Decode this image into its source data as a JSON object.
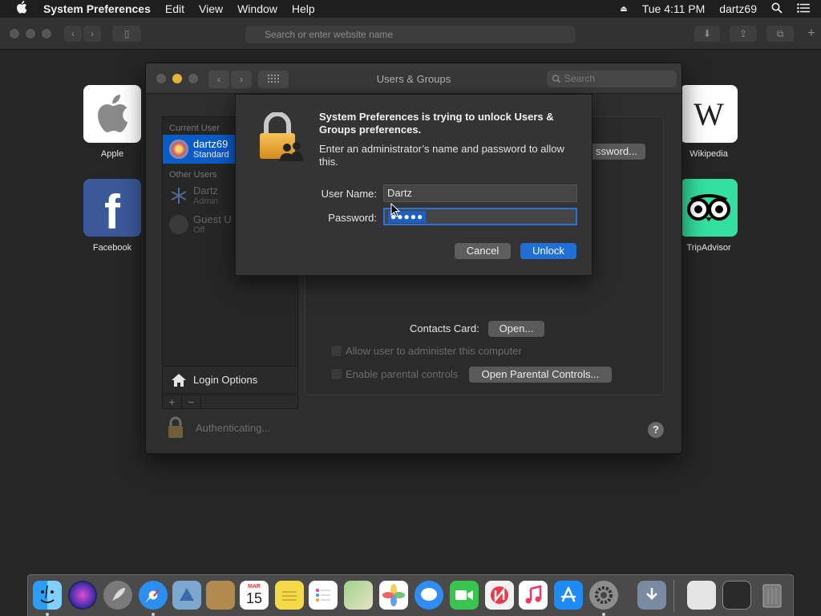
{
  "menubar": {
    "app_name": "System Preferences",
    "menus": [
      "Edit",
      "View",
      "Window",
      "Help"
    ],
    "clock": "Tue 4:11 PM",
    "user": "dartz69"
  },
  "safari": {
    "address_placeholder": "Search or enter website name",
    "favorites": [
      "Apple",
      "Facebook",
      "Wikipedia",
      "TripAdvisor"
    ]
  },
  "sysprefs": {
    "window_title": "Users & Groups",
    "search_placeholder": "Search",
    "current_user_header": "Current User",
    "current_user": {
      "name": "dartz69",
      "role": "Standard"
    },
    "other_users_header": "Other Users",
    "other_users": [
      {
        "name": "Dartz",
        "role": "Admin"
      },
      {
        "name": "Guest U",
        "role": "Off"
      }
    ],
    "login_options": "Login Options",
    "password_button": "ssword...",
    "contacts_card_label": "Contacts Card:",
    "open_button": "Open...",
    "allow_admin_label": "Allow user to administer this computer",
    "parental_label": "Enable parental controls",
    "open_parental_button": "Open Parental Controls...",
    "lock_status": "Authenticating...",
    "help": "?"
  },
  "auth_dialog": {
    "title": "System Preferences is trying to unlock Users & Groups preferences.",
    "message": "Enter an administrator’s name and password to allow this.",
    "username_label": "User Name:",
    "username_value": "Dartz",
    "password_label": "Password:",
    "password_mask": "●●●●●",
    "cancel": "Cancel",
    "unlock": "Unlock"
  },
  "dock": {
    "calendar_month": "MAR",
    "calendar_day": "15",
    "apps": [
      "finder",
      "siri",
      "launchpad",
      "safari",
      "mail",
      "notes-brown",
      "calendar",
      "stickies",
      "reminders",
      "maps",
      "photos",
      "messages",
      "facetime",
      "news",
      "music",
      "app-store",
      "system-preferences",
      "downloads",
      "document",
      "screenshot",
      "trash"
    ]
  }
}
